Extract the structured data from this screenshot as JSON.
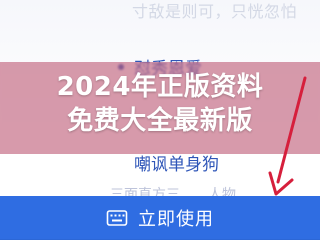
{
  "top_ghost": "寸敌是则可，只恍忽怕",
  "menu": {
    "items": [
      {
        "label": "怼秀恩爱"
      },
      {
        "label": "嘲讽单身狗"
      }
    ]
  },
  "overlay": {
    "line1": "2024年正版资料",
    "line2": "免费大全最新版"
  },
  "faded_row": "三面直方三……人物……",
  "cta": {
    "label": "立即使用",
    "icon": "keyboard-icon",
    "color": "#2f6de2"
  },
  "colors": {
    "accent": "#2f56b8",
    "overlay": "#bf5c78"
  }
}
